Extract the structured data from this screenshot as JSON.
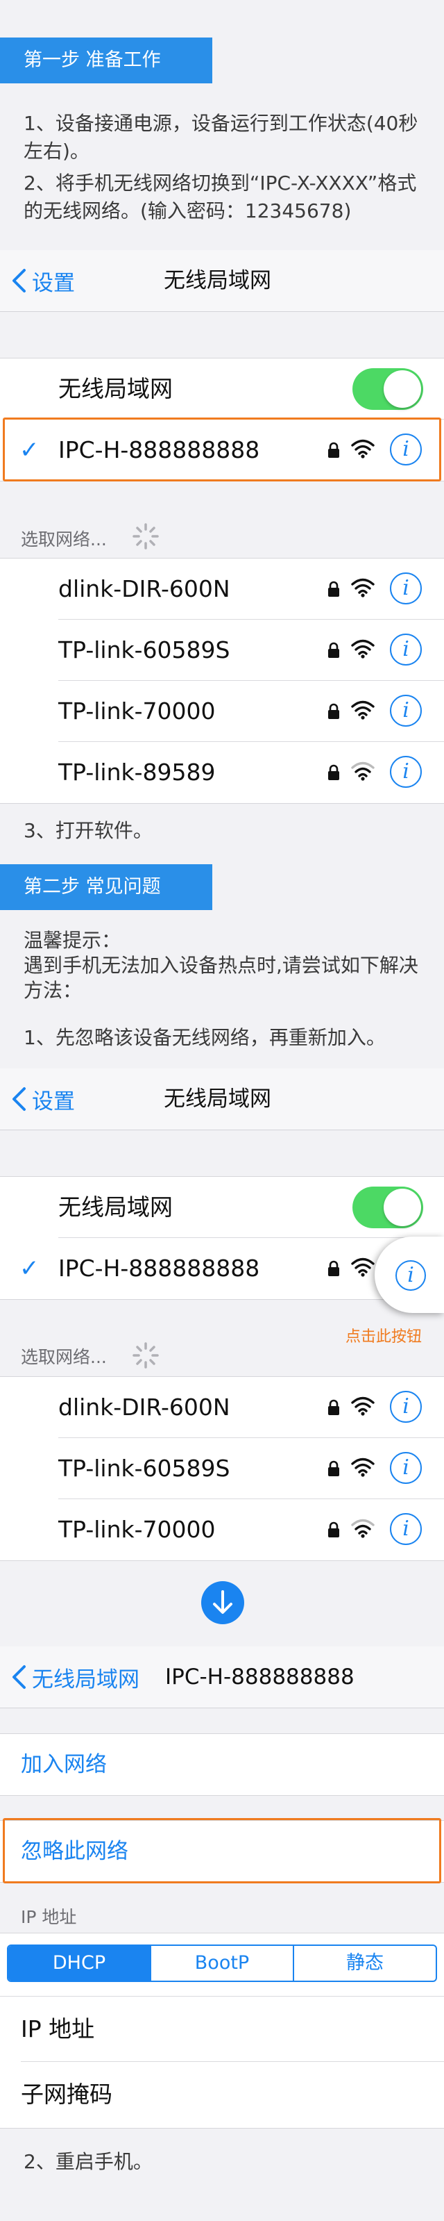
{
  "step1": {
    "tag": "第一步  准备工作",
    "line1": "1、设备接通电源，设备运行到工作状态(40秒左右)。",
    "line2": "2、将手机无线网络切换到“IPC-X-XXXX”格式的无线网络。(输入密码：12345678)"
  },
  "screen1": {
    "back_label": "设置",
    "title": "无线局域网",
    "wlan_label": "无线局域网",
    "connected_network": "IPC-H-888888888",
    "choose_network": "选取网络...",
    "networks": [
      "dlink-DIR-600N",
      "TP-link-60589S",
      "TP-link-70000",
      "TP-link-89589"
    ]
  },
  "step3": "3、打开软件。",
  "step2": {
    "tag": "第二步  常见问题",
    "tip_title": "温馨提示：",
    "tip_body": "遇到手机无法加入设备热点时,请尝试如下解决方法：",
    "solution1": "1、先忽略该设备无线网络，再重新加入。"
  },
  "screen2": {
    "back_label": "设置",
    "title": "无线局域网",
    "wlan_label": "无线局域网",
    "connected_network": "IPC-H-888888888",
    "click_hint": "点击此按钮",
    "choose_network": "选取网络...",
    "networks": [
      "dlink-DIR-600N",
      "TP-link-60589S",
      "TP-link-70000"
    ]
  },
  "screen3": {
    "back_label": "无线局域网",
    "title": "IPC-H-888888888",
    "join_network": "加入网络",
    "forget_network": "忽略此网络",
    "ip_section": "IP 地址",
    "segments": [
      "DHCP",
      "BootP",
      "静态"
    ],
    "ip_address": "IP 地址",
    "subnet_mask": "子网掩码"
  },
  "final_step": "2、重启手机。",
  "colors": {
    "accent": "#1a84f0",
    "step_tag": "#2a8fe8",
    "highlight": "#f07b1f",
    "toggle_on": "#4cd964"
  }
}
